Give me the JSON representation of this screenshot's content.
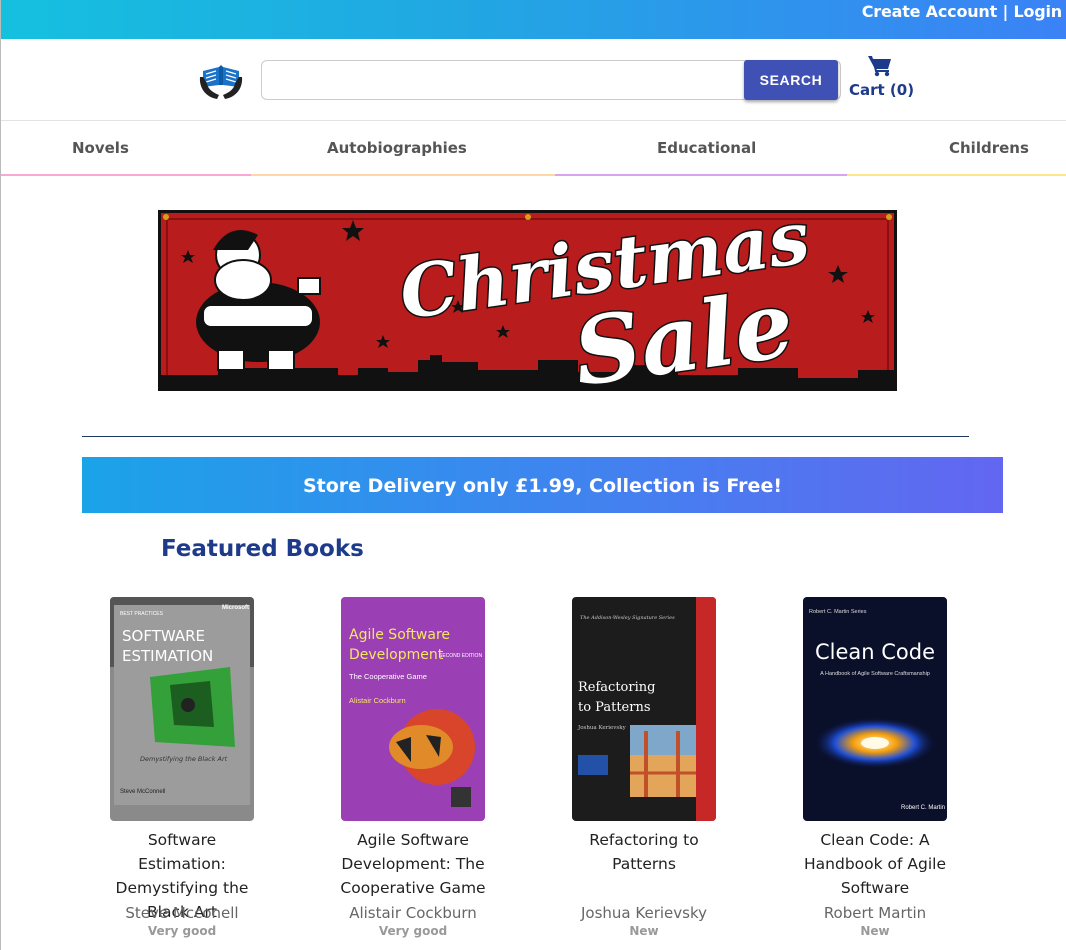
{
  "topbar": {
    "create_account": "Create Account",
    "separator": "|",
    "login": "Login"
  },
  "header": {
    "search_placeholder": "",
    "search_button": "SEARCH",
    "cart_label": "Cart (0)"
  },
  "categories": [
    {
      "label": "Novels",
      "underline_color": "#f9a8d4"
    },
    {
      "label": "Autobiographies",
      "underline_color": "#fdd8a6"
    },
    {
      "label": "Educational",
      "underline_color": "#d8a4f0"
    },
    {
      "label": "Childrens",
      "underline_color": "#fde68a"
    }
  ],
  "banner": {
    "line1": "Christmas",
    "line2": "Sale",
    "colors": {
      "background": "#b91c1c",
      "text": "#ffffff",
      "outline": "#111111"
    }
  },
  "delivery_notice": "Store Delivery only £1.99, Collection is Free!",
  "featured_title": "Featured Books",
  "books": [
    {
      "title": "Software Estimation: Demystifying the Black Art",
      "author": "Steve Mcconell",
      "condition": "Very good",
      "cover": {
        "label": "BEST PRACTICES",
        "publisher": "Microsoft",
        "title_line1": "SOFTWARE",
        "title_line2": "ESTIMATION",
        "subtitle": "Demystifying the Black Art",
        "author": "Steve McConnell"
      }
    },
    {
      "title": "Agile Software Development: The Cooperative Game",
      "author": "Alistair Cockburn",
      "condition": "Very good",
      "cover": {
        "title_line1": "Agile Software",
        "title_line2": "Development",
        "edition": "SECOND EDITION",
        "subtitle": "The Cooperative Game",
        "author": "Alistair Cockburn"
      }
    },
    {
      "title": "Refactoring to Patterns",
      "author": "Joshua Kerievsky",
      "condition": "New",
      "cover": {
        "series": "The Addison-Wesley Signature Series",
        "title_line1": "Refactoring",
        "title_line2": "to Patterns",
        "author": "Joshua Kerievsky"
      }
    },
    {
      "title": "Clean Code: A Handbook of Agile Software",
      "author": "Robert Martin",
      "condition": "New",
      "cover": {
        "series": "Robert C. Martin Series",
        "title": "Clean Code",
        "subtitle": "A Handbook of Agile Software Craftsmanship",
        "author": "Robert C. Martin"
      }
    }
  ]
}
